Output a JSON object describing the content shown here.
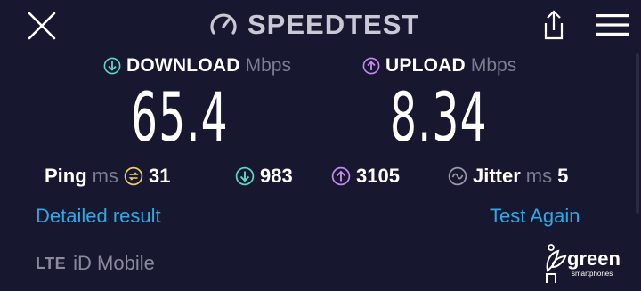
{
  "header": {
    "title": "SPEEDTEST",
    "close_icon": "close-icon",
    "share_icon": "share-icon",
    "menu_icon": "hamburger-menu-icon"
  },
  "download": {
    "label": "DOWNLOAD",
    "unit": "Mbps",
    "value": "65.4",
    "color": "#5fd8c8"
  },
  "upload": {
    "label": "UPLOAD",
    "unit": "Mbps",
    "value": "8.34",
    "color": "#c58cf0"
  },
  "ping": {
    "label": "Ping",
    "unit": "ms",
    "value": "31",
    "color": "#f0d060"
  },
  "download_latency": {
    "value": "983"
  },
  "upload_latency": {
    "value": "3105"
  },
  "jitter": {
    "label": "Jitter",
    "unit": "ms",
    "value": "5",
    "color": "#9a9aac"
  },
  "links": {
    "detailed": "Detailed result",
    "test_again": "Test Again",
    "color": "#2fa8e4"
  },
  "connection": {
    "type": "LTE",
    "provider": "iD Mobile"
  },
  "watermark": {
    "text": "green",
    "sub": "smartphones"
  }
}
